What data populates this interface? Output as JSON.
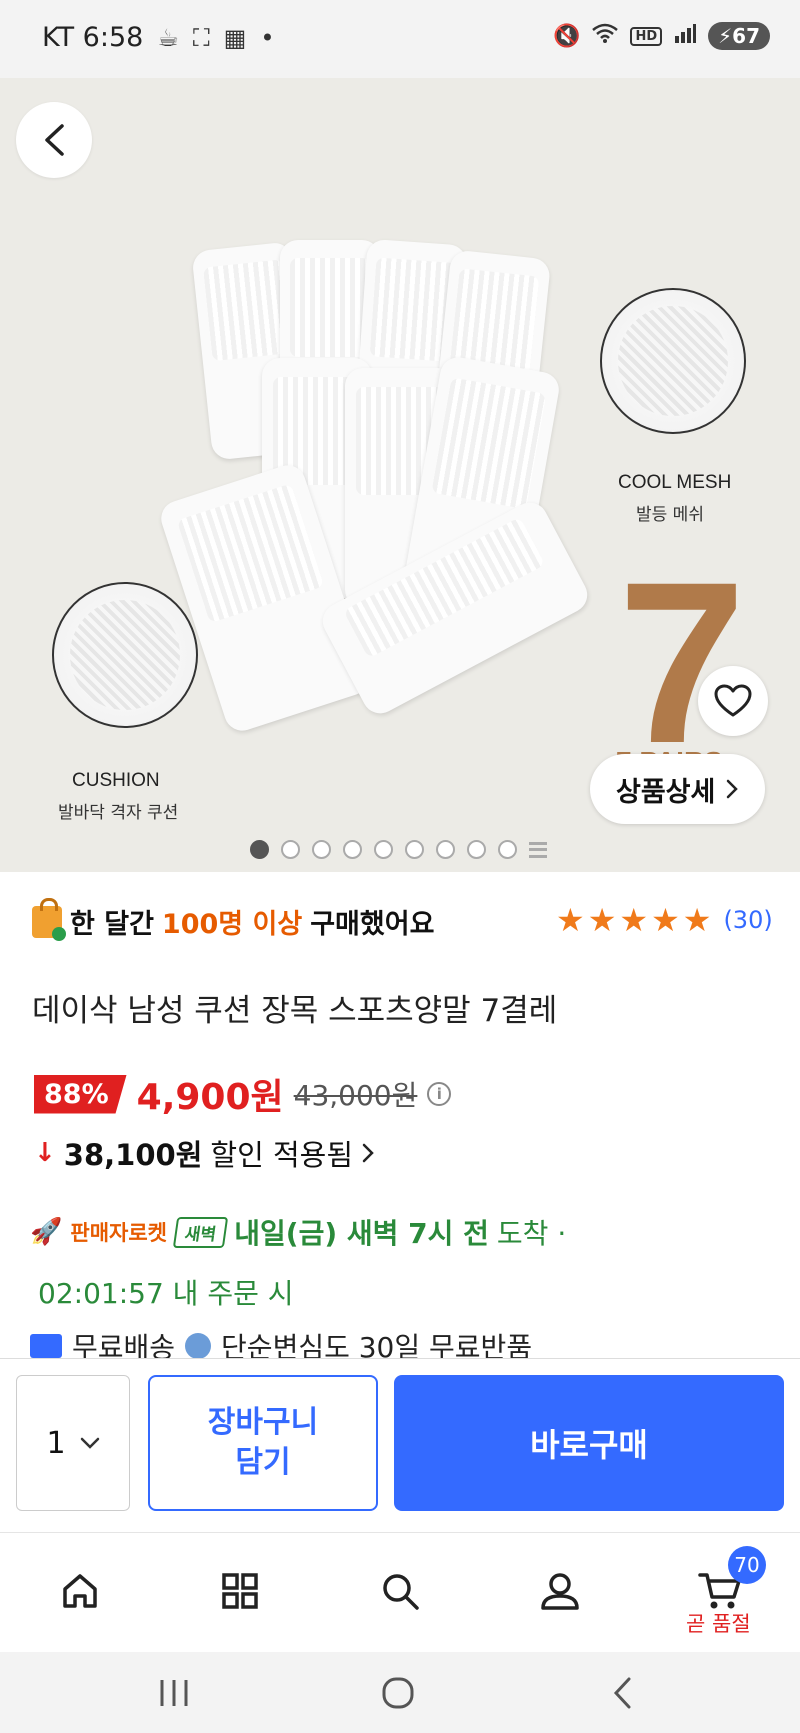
{
  "status_bar": {
    "carrier_time": "KT 6:58",
    "battery": "67",
    "extra_glyph": "•"
  },
  "hero": {
    "feature1_title": "COOL MESH",
    "feature1_sub": "발등 메쉬",
    "feature2_title": "CUSHION",
    "feature2_sub": "발바닥 격자 쿠션",
    "big_number": "7",
    "pairs_text": "7 PAIRS",
    "detail_button": "상품상세",
    "image_count": 9
  },
  "social_proof": {
    "prefix": "한 달간",
    "highlight": "100명 이상",
    "suffix": "구매했어요",
    "rating_count": "(30)",
    "stars": 5
  },
  "product": {
    "title": "데이삭 남성 쿠션 장목 스포츠양말 7결레",
    "discount": "88%",
    "price": "4,900원",
    "original_price": "43,000원",
    "saved_amount": "38,100원",
    "saved_label": "할인 적용됨"
  },
  "delivery": {
    "seller_rocket": "판매자로켓",
    "badge": "새벽",
    "arrival": "내일(금) 새벽 7시 전",
    "arrival_suffix": "도착 ·",
    "countdown": "02:01:57 내 주문 시",
    "free_shipping": "무료배송",
    "free_return": "단순변심도 30일 무료반품"
  },
  "actions": {
    "quantity": "1",
    "cart_line1": "장바구니",
    "cart_line2": "담기",
    "buy_now": "바로구매"
  },
  "bottom_nav": {
    "cart_count": "70",
    "soldout_label": "곧 품절"
  },
  "colors": {
    "accent_blue": "#346aff",
    "sale_red": "#e02020",
    "delivery_green": "#2a8a3a",
    "highlight_orange": "#e65b00"
  }
}
